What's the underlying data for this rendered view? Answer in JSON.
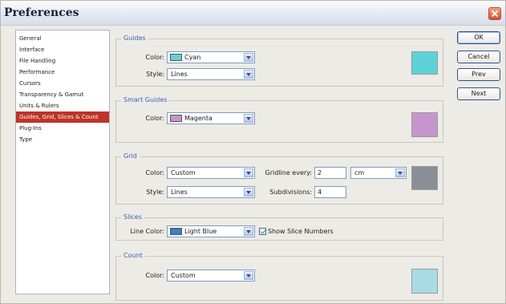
{
  "window": {
    "title": "Preferences"
  },
  "sidebar": {
    "items": [
      {
        "label": "General"
      },
      {
        "label": "Interface"
      },
      {
        "label": "File Handling"
      },
      {
        "label": "Performance"
      },
      {
        "label": "Cursors"
      },
      {
        "label": "Transparency & Gamut"
      },
      {
        "label": "Units & Rulers"
      },
      {
        "label": "Guides, Grid, Slices & Count"
      },
      {
        "label": "Plug-Ins"
      },
      {
        "label": "Type"
      }
    ],
    "selected_index": 7
  },
  "guides": {
    "legend": "Guides",
    "color_label": "Color:",
    "color_value": "Cyan",
    "color_hex": "#5fd2d8",
    "style_label": "Style:",
    "style_value": "Lines"
  },
  "smart_guides": {
    "legend": "Smart Guides",
    "color_label": "Color:",
    "color_value": "Magenta",
    "color_hex": "#c596cc"
  },
  "grid": {
    "legend": "Grid",
    "color_label": "Color:",
    "color_value": "Custom",
    "color_hex": "#8a8f97",
    "style_label": "Style:",
    "style_value": "Lines",
    "gridline_label": "Gridline every:",
    "gridline_value": "2",
    "unit_value": "cm",
    "subdivisions_label": "Subdivisions:",
    "subdivisions_value": "4"
  },
  "slices": {
    "legend": "Slices",
    "line_color_label": "Line Color:",
    "line_color_value": "Light Blue",
    "line_color_hex": "#3a7fc8",
    "show_numbers_label": "Show Slice Numbers",
    "show_numbers_checked": true
  },
  "count": {
    "legend": "Count",
    "color_label": "Color:",
    "color_value": "Custom",
    "color_hex": "#a9dbe6"
  },
  "buttons": {
    "ok": "OK",
    "cancel": "Cancel",
    "prev": "Prev",
    "next": "Next"
  }
}
